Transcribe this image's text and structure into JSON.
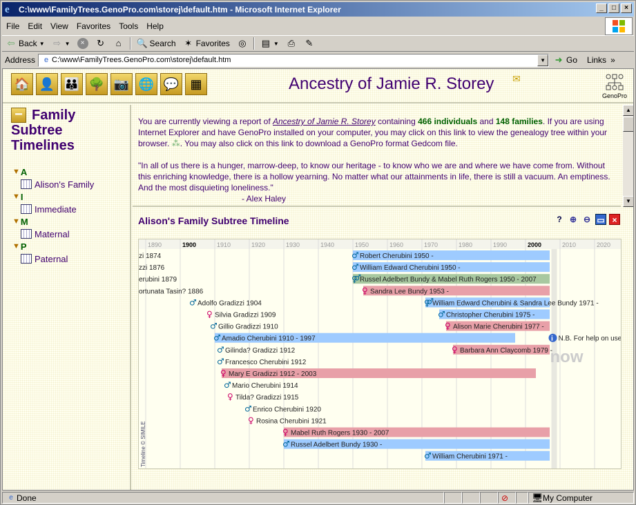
{
  "window": {
    "title": "C:\\www\\FamilyTrees.GenoPro.com\\storej\\default.htm - Microsoft Internet Explorer"
  },
  "menu": [
    "File",
    "Edit",
    "View",
    "Favorites",
    "Tools",
    "Help"
  ],
  "toolbar": {
    "back": "Back",
    "search": "Search",
    "favorites": "Favorites"
  },
  "address": {
    "label": "Address",
    "url": "C:\\www\\FamilyTrees.GenoPro.com\\storej\\default.htm",
    "go": "Go",
    "links": "Links"
  },
  "header": {
    "title": "Ancestry of Jamie R. Storey",
    "logo": "GenoPro"
  },
  "sidebar": {
    "heading": "Family Subtree Timelines",
    "groups": [
      {
        "letter": "A",
        "item": "Alison's Family"
      },
      {
        "letter": "I",
        "item": "Immediate"
      },
      {
        "letter": "M",
        "item": "Maternal"
      },
      {
        "letter": "P",
        "item": "Paternal"
      }
    ]
  },
  "intro": {
    "p1a": "You are currently viewing a report of ",
    "p1link": "Ancestry of Jamie R. Storey",
    "p1b": " containing ",
    "individuals": "466 individuals",
    "p1c": " and ",
    "families": "148 families",
    "p1d": ". If you are using Internet Explorer and have GenoPro installed on your computer, you may click on this link to view the genealogy tree within your browser. ",
    "p1e": ". You may also click on this link to download a GenoPro format Gedcom file.",
    "quote": "\"In all of us there is a hunger, marrow-deep, to know our heritage - to know who we are and where we have come from. Without this enriching knowledge, there is a hollow yearning.  No matter what our attainments in life, there is still a vacuum. An emptiness. And the most disquieting loneliness.\"",
    "author": "- Alex Haley"
  },
  "timeline": {
    "title": "Alison's Family Subtree Timeline",
    "credit": "Timeline © SIMILE",
    "now_label": "now",
    "help": "N.B. For help on use",
    "decades": [
      1890,
      1900,
      1910,
      1920,
      1930,
      1940,
      1950,
      1960,
      1970,
      1980,
      1990,
      2000,
      2010,
      2020
    ],
    "events": [
      {
        "label": "zi 1874",
        "start": 1845,
        "end": 1874,
        "sex": "none",
        "kind": "text"
      },
      {
        "label": "zzi 1876",
        "start": 1845,
        "end": 1876,
        "sex": "none",
        "kind": "text"
      },
      {
        "label": "erubini 1879",
        "start": 1845,
        "end": 1879,
        "sex": "none",
        "kind": "text"
      },
      {
        "label": "ortunata Tasin? 1886",
        "start": 1845,
        "end": 1886,
        "sex": "none",
        "kind": "text"
      },
      {
        "label": "Adolfo Gradizzi 1904",
        "start": 1903,
        "end": 1904,
        "sex": "m",
        "kind": "point"
      },
      {
        "label": "Silvia Gradizzi 1909",
        "start": 1908,
        "end": 1909,
        "sex": "f",
        "kind": "point"
      },
      {
        "label": "Gillio Gradizzi 1910",
        "start": 1909,
        "end": 1910,
        "sex": "m",
        "kind": "point"
      },
      {
        "label": "Amadio Cherubini 1910 - 1997",
        "start": 1910,
        "end": 1997,
        "sex": "m",
        "kind": "bar"
      },
      {
        "label": "Gilinda? Gradizzi 1912",
        "start": 1911,
        "end": 1912,
        "sex": "m",
        "kind": "point"
      },
      {
        "label": "Francesco Cherubini 1912",
        "start": 1911,
        "end": 1912,
        "sex": "m",
        "kind": "point"
      },
      {
        "label": "Mary E Gradizzi 1912 - 2003",
        "start": 1912,
        "end": 2003,
        "sex": "f",
        "kind": "bar"
      },
      {
        "label": "Mario Cherubini 1914",
        "start": 1913,
        "end": 1914,
        "sex": "m",
        "kind": "point"
      },
      {
        "label": "Tilda? Gradizzi 1915",
        "start": 1914,
        "end": 1915,
        "sex": "f",
        "kind": "point"
      },
      {
        "label": "Enrico Cherubini 1920",
        "start": 1919,
        "end": 1920,
        "sex": "m",
        "kind": "point"
      },
      {
        "label": "Rosina Cherubini 1921",
        "start": 1920,
        "end": 1921,
        "sex": "f",
        "kind": "point"
      },
      {
        "label": "Mabel Ruth Rogers 1930 - 2007",
        "start": 1930,
        "end": 2007,
        "sex": "f",
        "kind": "bar"
      },
      {
        "label": "Russel Adelbert Bundy 1930 -",
        "start": 1930,
        "end": 2007,
        "sex": "m",
        "kind": "bar"
      },
      {
        "label": "William Cherubini 1971 -",
        "start": 1971,
        "end": 2007,
        "sex": "m",
        "kind": "bar"
      },
      {
        "label": "Robert Cherubini 1950 -",
        "start": 1950,
        "end": 2007,
        "sex": "m",
        "kind": "bar"
      },
      {
        "label": "William Edward Cherubini 1950 -",
        "start": 1950,
        "end": 2007,
        "sex": "m",
        "kind": "bar"
      },
      {
        "label": "Russel Adelbert Bundy & Mabel Ruth Rogers 1950 - 2007",
        "start": 1950,
        "end": 2007,
        "sex": "c",
        "kind": "bar"
      },
      {
        "label": "Sandra Lee Bundy 1953 -",
        "start": 1953,
        "end": 2007,
        "sex": "f",
        "kind": "bar"
      },
      {
        "label": "William Edward Cherubini & Sandra Lee Bundy 1971 -",
        "start": 1971,
        "end": 2007,
        "sex": "c2",
        "kind": "bar"
      },
      {
        "label": "Christopher Cherubini 1975 -",
        "start": 1975,
        "end": 2007,
        "sex": "m",
        "kind": "bar"
      },
      {
        "label": "Alison Marie Cherubini 1977 -",
        "start": 1977,
        "end": 2007,
        "sex": "f",
        "kind": "bar"
      },
      {
        "label": "Barbara Ann Claycomb 1979 -",
        "start": 1979,
        "end": 2007,
        "sex": "f",
        "kind": "bar"
      }
    ]
  },
  "status": {
    "done": "Done",
    "zone": "My Computer"
  },
  "colors": {
    "male": "#9ecbff",
    "female": "#e8a0a8",
    "couple": "#a8c8a0",
    "title": "#400070"
  }
}
